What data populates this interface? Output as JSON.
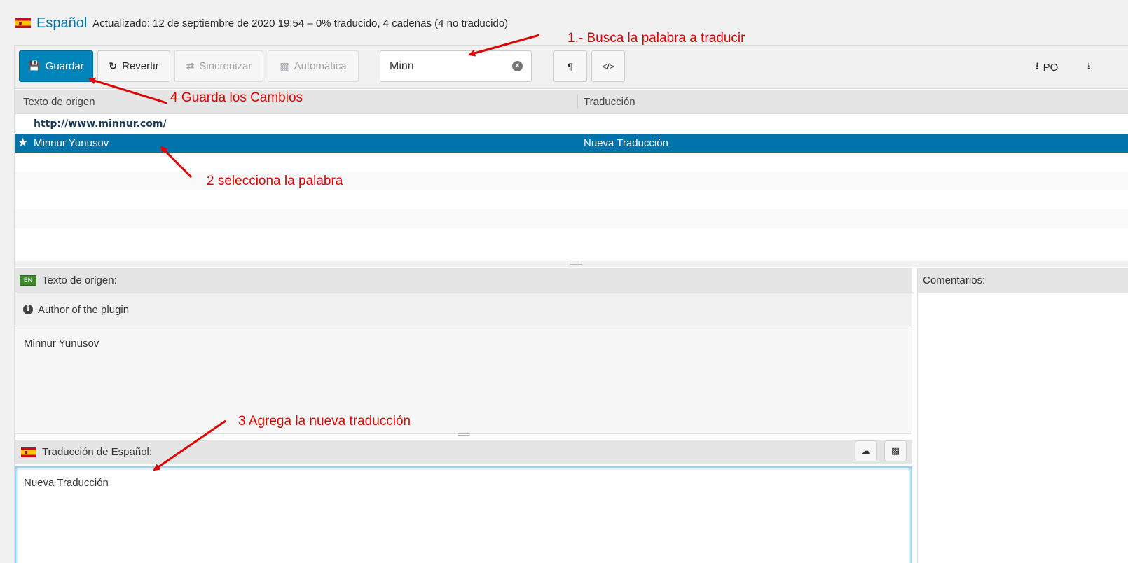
{
  "header": {
    "language": "Español",
    "status": "Actualizado: 12 de septiembre de 2020 19:54 – 0% traducido, 4 cadenas (4 no traducido)"
  },
  "toolbar": {
    "save_label": "Guardar",
    "revert_label": "Revertir",
    "sync_label": "Sincronizar",
    "auto_label": "Automática",
    "search_value": "Minn",
    "invisibles_label": "¶",
    "code_label": "</>",
    "download_po_label": "PO"
  },
  "grid": {
    "col_source": "Texto de origen",
    "col_translation": "Traducción",
    "rows": [
      {
        "source": "http://www.minnur.com/",
        "translation": "",
        "context": true
      },
      {
        "source": "Minnur Yunusov",
        "translation": "Nueva Traducción",
        "selected": true
      }
    ]
  },
  "source_pane": {
    "title": "Texto de origen:",
    "flag_label": "EN",
    "info": "Author of the plugin",
    "text": "Minnur Yunusov"
  },
  "comments_pane": {
    "title": "Comentarios:"
  },
  "target_pane": {
    "title": "Traducción de Español:",
    "text": "Nueva Traducción"
  },
  "annotations": {
    "step1": "1.- Busca la palabra a traducir",
    "step2": "2 selecciona la palabra",
    "step3": "3 Agrega la nueva traducción",
    "step4": "4 Guarda los Cambios",
    "color": "#e00000"
  },
  "colors": {
    "primary": "#0085ba",
    "selected_row": "#0073aa",
    "link": "#0073aa"
  }
}
